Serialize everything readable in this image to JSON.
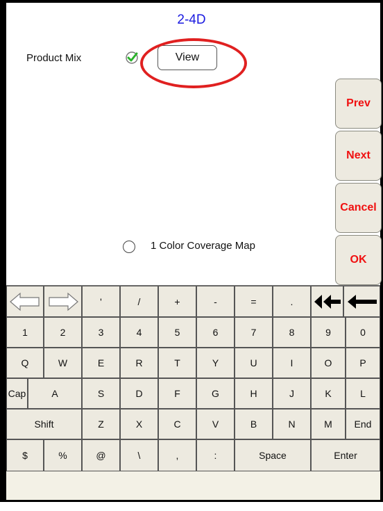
{
  "title": "2-4D",
  "product_mix": {
    "label": "Product Mix",
    "checked": true,
    "view_label": "View"
  },
  "side_buttons": {
    "prev": "Prev",
    "next": "Next",
    "cancel": "Cancel",
    "ok": "OK"
  },
  "coverage": {
    "label": "1 Color Coverage Map",
    "selected": false
  },
  "keyboard": {
    "row0": [
      "left-arrow-icon",
      "right-arrow-icon",
      "'",
      "/",
      "+",
      "-",
      "=",
      ".",
      "double-left-arrow-icon",
      "backspace-arrow-icon"
    ],
    "row1": [
      "1",
      "2",
      "3",
      "4",
      "5",
      "6",
      "7",
      "8",
      "9",
      "0"
    ],
    "row2": [
      "Q",
      "W",
      "E",
      "R",
      "T",
      "Y",
      "U",
      "I",
      "O",
      "P"
    ],
    "row3": [
      "Cap",
      "A",
      "S",
      "D",
      "F",
      "G",
      "H",
      "J",
      "K",
      "L"
    ],
    "row4": [
      "Shift",
      "Z",
      "X",
      "C",
      "V",
      "B",
      "N",
      "M",
      "End"
    ],
    "row5": [
      "$",
      "%",
      "@",
      "\\",
      ",",
      ":",
      "Space",
      "Enter"
    ]
  }
}
